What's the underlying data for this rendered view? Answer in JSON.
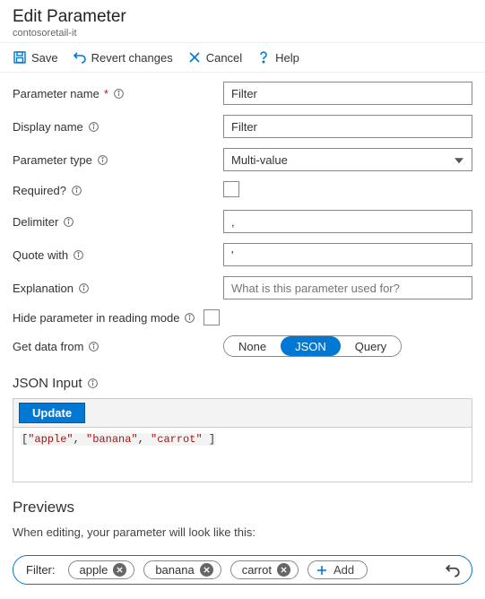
{
  "header": {
    "title": "Edit Parameter",
    "subtitle": "contosoretail-it"
  },
  "toolbar": {
    "save": "Save",
    "revert": "Revert changes",
    "cancel": "Cancel",
    "help": "Help"
  },
  "form": {
    "param_name": {
      "label": "Parameter name",
      "value": "Filter"
    },
    "display_name": {
      "label": "Display name",
      "value": "Filter"
    },
    "parameter_type": {
      "label": "Parameter type",
      "value": "Multi-value"
    },
    "required": {
      "label": "Required?"
    },
    "delimiter": {
      "label": "Delimiter",
      "value": ","
    },
    "quote": {
      "label": "Quote with",
      "value": "'"
    },
    "explanation": {
      "label": "Explanation",
      "placeholder": "What is this parameter used for?"
    },
    "hide": {
      "label": "Hide parameter in reading mode"
    },
    "get_data": {
      "label": "Get data from",
      "options": [
        "None",
        "JSON",
        "Query"
      ],
      "selected": "JSON"
    }
  },
  "json_input": {
    "title": "JSON Input",
    "update": "Update",
    "open": "[",
    "s1": "\"apple\"",
    "s2": "\"banana\"",
    "s3": "\"carrot\"",
    "close": "]",
    "sep": ", "
  },
  "previews": {
    "title": "Previews",
    "desc": "When editing, your parameter will look like this:",
    "filter_label": "Filter:",
    "tags": [
      "apple",
      "banana",
      "carrot"
    ],
    "add": "Add"
  }
}
